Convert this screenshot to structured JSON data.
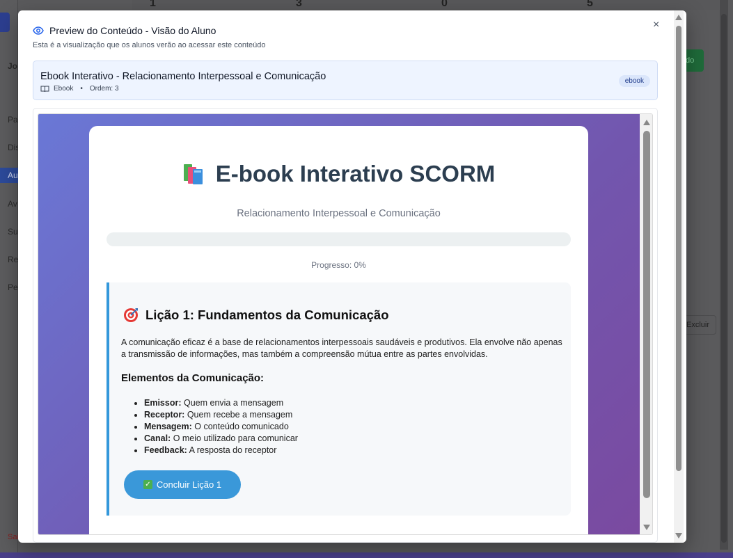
{
  "background": {
    "top_numbers": [
      "1",
      "3",
      "0",
      "5"
    ],
    "nav": [
      "Pai",
      "Dis",
      "Au",
      "Av",
      "Su",
      "Re",
      "Pe"
    ],
    "user_initial": "Jo",
    "excluir": "Excluir",
    "green_btn": "do",
    "sair": "Sai"
  },
  "modal": {
    "title": "Preview do Conteúdo - Visão do Aluno",
    "subtitle": "Esta é a visualização que os alunos verão ao acessar este conteúdo",
    "close": "×",
    "info": {
      "title": "Ebook Interativo - Relacionamento Interpessoal e Comunicação",
      "type": "Ebook",
      "separator": "•",
      "order": "Ordem: 3",
      "badge": "ebook"
    }
  },
  "ebook": {
    "title": "E-book Interativo SCORM",
    "subtitle": "Relacionamento Interpessoal e Comunicação",
    "progress_label": "Progresso: 0%",
    "progress_value": 0,
    "lesson": {
      "title": "Lição 1: Fundamentos da Comunicação",
      "text": "A comunicação eficaz é a base de relacionamentos interpessoais saudáveis e produtivos. Ela envolve não apenas a transmissão de informações, mas também a compreensão mútua entre as partes envolvidas.",
      "elements_heading": "Elementos da Comunicação:",
      "items": [
        {
          "term": "Emissor:",
          "desc": "Quem envia a mensagem"
        },
        {
          "term": "Receptor:",
          "desc": "Quem recebe a mensagem"
        },
        {
          "term": "Mensagem:",
          "desc": "O conteúdo comunicado"
        },
        {
          "term": "Canal:",
          "desc": "O meio utilizado para comunicar"
        },
        {
          "term": "Feedback:",
          "desc": "A resposta do receptor"
        }
      ],
      "button": "Concluir Lição 1"
    }
  },
  "colors": {
    "accent": "#3498db",
    "gradient_start": "#6a78d6",
    "gradient_end": "#7a4aa0",
    "badge_bg": "#dbe6fb"
  },
  "icons": {
    "preview": "eye-icon",
    "book": "book-open-icon",
    "books": "books-emoji-icon",
    "target": "target-emoji-icon",
    "check": "check-box-icon",
    "close": "close-icon"
  }
}
